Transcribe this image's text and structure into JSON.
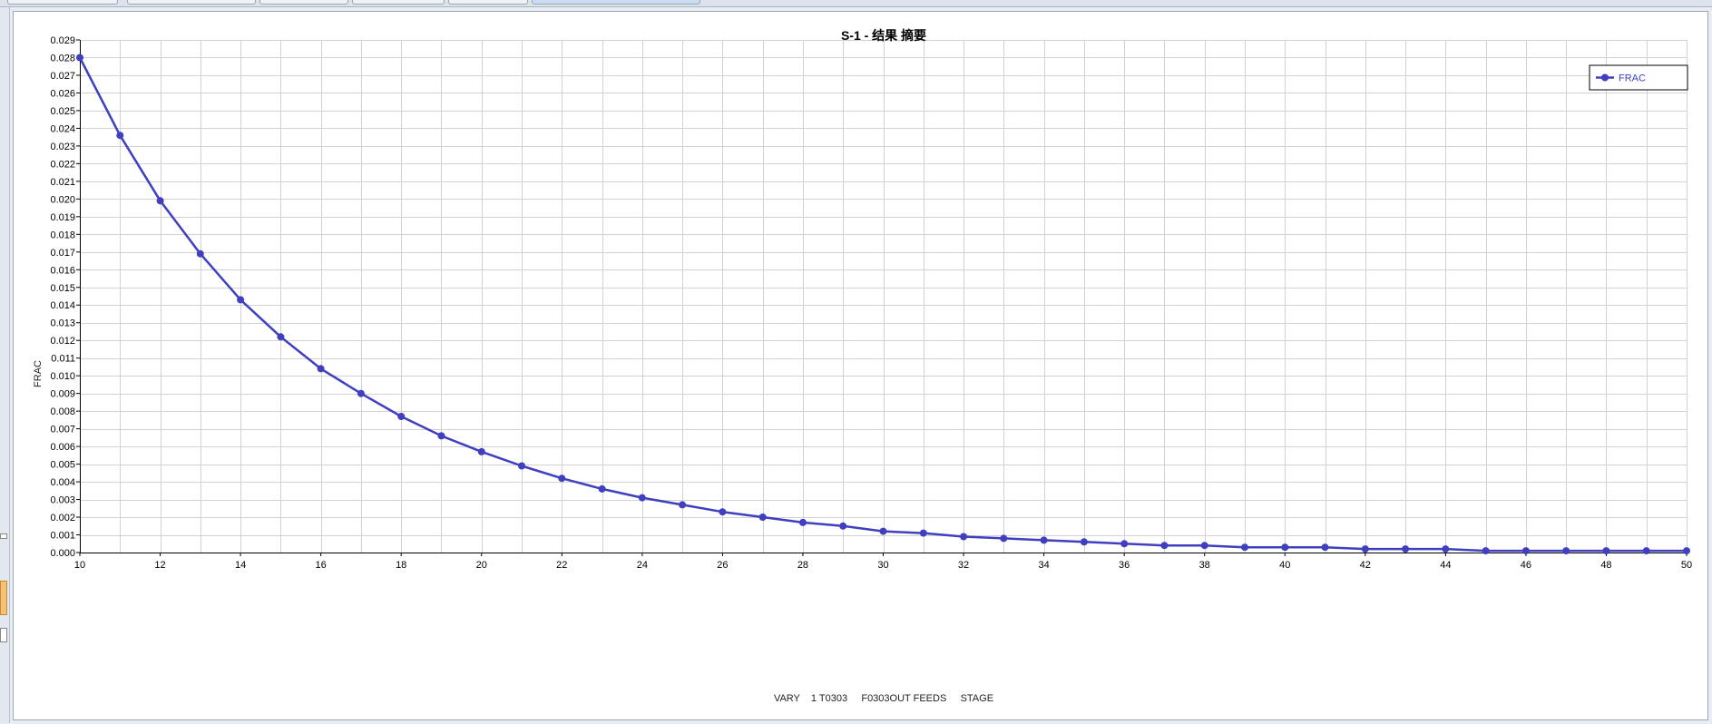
{
  "chart_data": {
    "type": "line",
    "title": "S-1 - 结果 摘要",
    "xlabel": "VARY    1 T0303     F0303OUT FEEDS     STAGE",
    "ylabel": "FRAC",
    "xlim": [
      10,
      50
    ],
    "ylim": [
      0,
      0.029
    ],
    "x_ticks": [
      10,
      12,
      14,
      16,
      18,
      20,
      22,
      24,
      26,
      28,
      30,
      32,
      34,
      36,
      38,
      40,
      42,
      44,
      46,
      48,
      50
    ],
    "y_ticks": [
      0.0,
      0.001,
      0.002,
      0.003,
      0.004,
      0.005,
      0.006,
      0.007,
      0.008,
      0.009,
      0.01,
      0.011,
      0.012,
      0.013,
      0.014,
      0.015,
      0.016,
      0.017,
      0.018,
      0.019,
      0.02,
      0.021,
      0.022,
      0.023,
      0.024,
      0.025,
      0.026,
      0.027,
      0.028,
      0.029
    ],
    "grid": true,
    "legend_position": "top-right",
    "series": [
      {
        "name": "FRAC",
        "color": "#3f3fbf",
        "x": [
          10,
          11,
          12,
          13,
          14,
          15,
          16,
          17,
          18,
          19,
          20,
          21,
          22,
          23,
          24,
          25,
          26,
          27,
          28,
          29,
          30,
          31,
          32,
          33,
          34,
          35,
          36,
          37,
          38,
          39,
          40,
          41,
          42,
          43,
          44,
          45,
          46,
          47,
          48,
          49,
          50
        ],
        "y": [
          0.028,
          0.0236,
          0.0199,
          0.0169,
          0.0143,
          0.0122,
          0.0104,
          0.009,
          0.0077,
          0.0066,
          0.0057,
          0.0049,
          0.0042,
          0.0036,
          0.0031,
          0.0027,
          0.0023,
          0.002,
          0.0017,
          0.0015,
          0.0012,
          0.0011,
          0.0009,
          0.0008,
          0.0007,
          0.0006,
          0.0005,
          0.0004,
          0.0004,
          0.0003,
          0.0003,
          0.0003,
          0.0002,
          0.0002,
          0.0002,
          0.0001,
          0.0001,
          0.0001,
          0.0001,
          0.0001,
          0.0001
        ]
      }
    ]
  }
}
